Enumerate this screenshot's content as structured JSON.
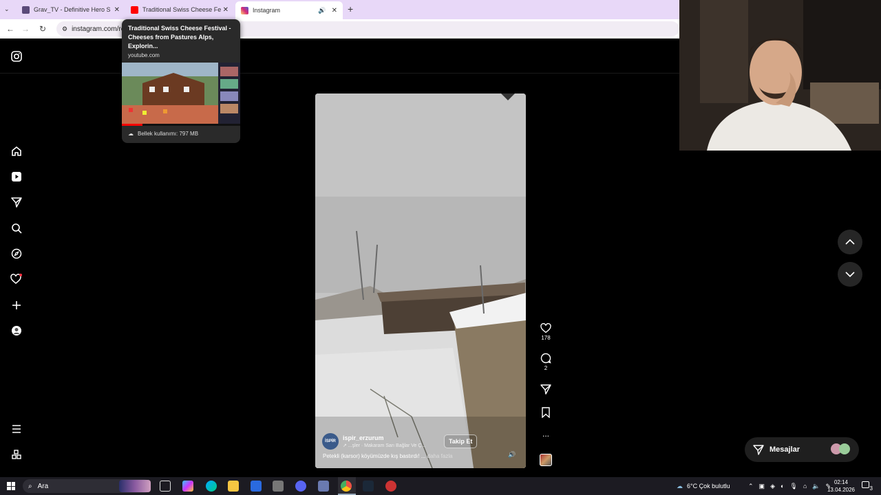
{
  "tabs": [
    {
      "label": "Grav_TV - Definitive Hero Sieg",
      "favicon_color": "#5b4a7a"
    },
    {
      "label": "Traditional Swiss Cheese Festival",
      "favicon_color": "#ff0000"
    },
    {
      "label": "Instagram",
      "favicon_color": "#d62976"
    }
  ],
  "new_tab": "+",
  "address": "instagram.com/re",
  "tooltip": {
    "title": "Traditional Swiss Cheese Festival - Cheeses from Pastures Alps, Explorin...",
    "domain": "youtube.com",
    "memory": "Bellek kullanımı: 797 MB"
  },
  "reel": {
    "username": "ispir_erzurum",
    "avatar_text": "İSPİR",
    "audio": "↗ ...şler · Makaram Sarı Bağlar Ve Ç...",
    "caption": "Petekli (karsor) köyümüzde kış bastırdı! ...",
    "more": "daha fazla",
    "follow": "Takip Et"
  },
  "actions": {
    "likes": "178",
    "comments": "2",
    "more": "..."
  },
  "messages_label": "Mesajlar",
  "taskbar": {
    "search": "Ara",
    "weather": "6°C  Çok bulutlu",
    "time": "02:14",
    "date": "13.04.2026",
    "notif": "3"
  },
  "colors": {
    "tabbar": "#e8d8f8",
    "accent": "#d62976",
    "page_bg": "#000000"
  }
}
